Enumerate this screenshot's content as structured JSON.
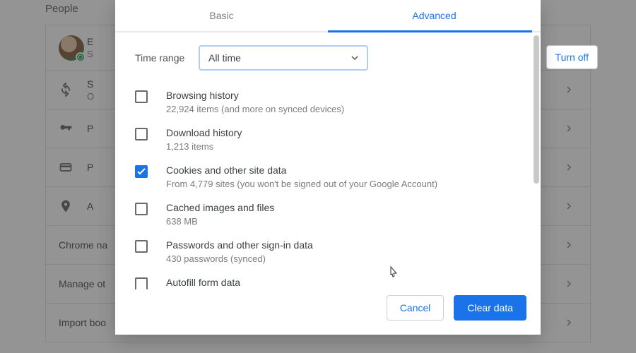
{
  "bg": {
    "section_title": "People",
    "profile": {
      "line1": "E",
      "line2": "S"
    },
    "rows": {
      "sync": {
        "line1": "S",
        "line2": "O"
      },
      "passwords": {
        "label": "P"
      },
      "payment": {
        "label": "P"
      },
      "addresses": {
        "label": "A"
      }
    },
    "simple": {
      "chrome_name": "Chrome na",
      "manage_other": "Manage ot",
      "import_boo": "Import boo"
    },
    "turn_off": "Turn off"
  },
  "dialog": {
    "tabs": {
      "basic": "Basic",
      "advanced": "Advanced"
    },
    "time_range_label": "Time range",
    "time_range_value": "All time",
    "options": {
      "browsing": {
        "title": "Browsing history",
        "sub": "22,924 items (and more on synced devices)",
        "checked": false
      },
      "download": {
        "title": "Download history",
        "sub": "1,213 items",
        "checked": false
      },
      "cookies": {
        "title": "Cookies and other site data",
        "sub": "From 4,779 sites (you won't be signed out of your Google Account)",
        "checked": true
      },
      "cache": {
        "title": "Cached images and files",
        "sub": "638 MB",
        "checked": false
      },
      "passwords": {
        "title": "Passwords and other sign-in data",
        "sub": "430 passwords (synced)",
        "checked": false
      },
      "autofill": {
        "title": "Autofill form data",
        "sub": "",
        "checked": false
      }
    },
    "buttons": {
      "cancel": "Cancel",
      "clear": "Clear data"
    }
  }
}
